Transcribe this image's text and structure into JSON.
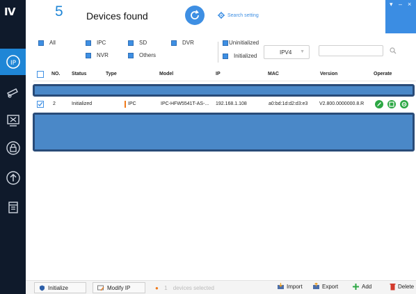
{
  "header": {
    "count": "5",
    "found_label": "Devices found",
    "search_setting_label": "Search setting",
    "window_controls": [
      "▾",
      "–",
      "×"
    ]
  },
  "filters": {
    "row1": [
      "All",
      "IPC",
      "SD",
      "DVR"
    ],
    "row2": [
      "NVR",
      "Others"
    ],
    "status": [
      "Uninitialized",
      "Initialized"
    ],
    "ip_version": "IPV4",
    "search_value": ""
  },
  "table": {
    "columns": [
      "NO.",
      "Status",
      "Type",
      "Model",
      "IP",
      "MAC",
      "Version",
      "Operate"
    ],
    "rows": [
      {
        "no": "2",
        "status": "Initialized",
        "type": "IPC",
        "model": "IPC-HFW5541T-AS-...",
        "ip": "192.168.1.108",
        "mac": "a0:bd:1d:d2:d3:e3",
        "version": "V2.800.0000000.8.R"
      }
    ]
  },
  "bottom": {
    "initialize_label": "Initialize",
    "modify_ip_label": "Modify IP",
    "selected_count": "1",
    "selected_label": "devices selected",
    "import_label": "Import",
    "export_label": "Export",
    "add_label": "Add",
    "delete_label": "Delete"
  },
  "icons": {
    "sidebar": [
      "logo",
      "ip-icon",
      "camera-icon",
      "tools-icon",
      "lock-icon",
      "upgrade-icon",
      "document-icon"
    ]
  },
  "colors": {
    "accent": "#3e8fe3",
    "sidebar_bg": "#0f1a2b",
    "status_green": "#2ca744",
    "type_orange": "#f07a1a"
  }
}
